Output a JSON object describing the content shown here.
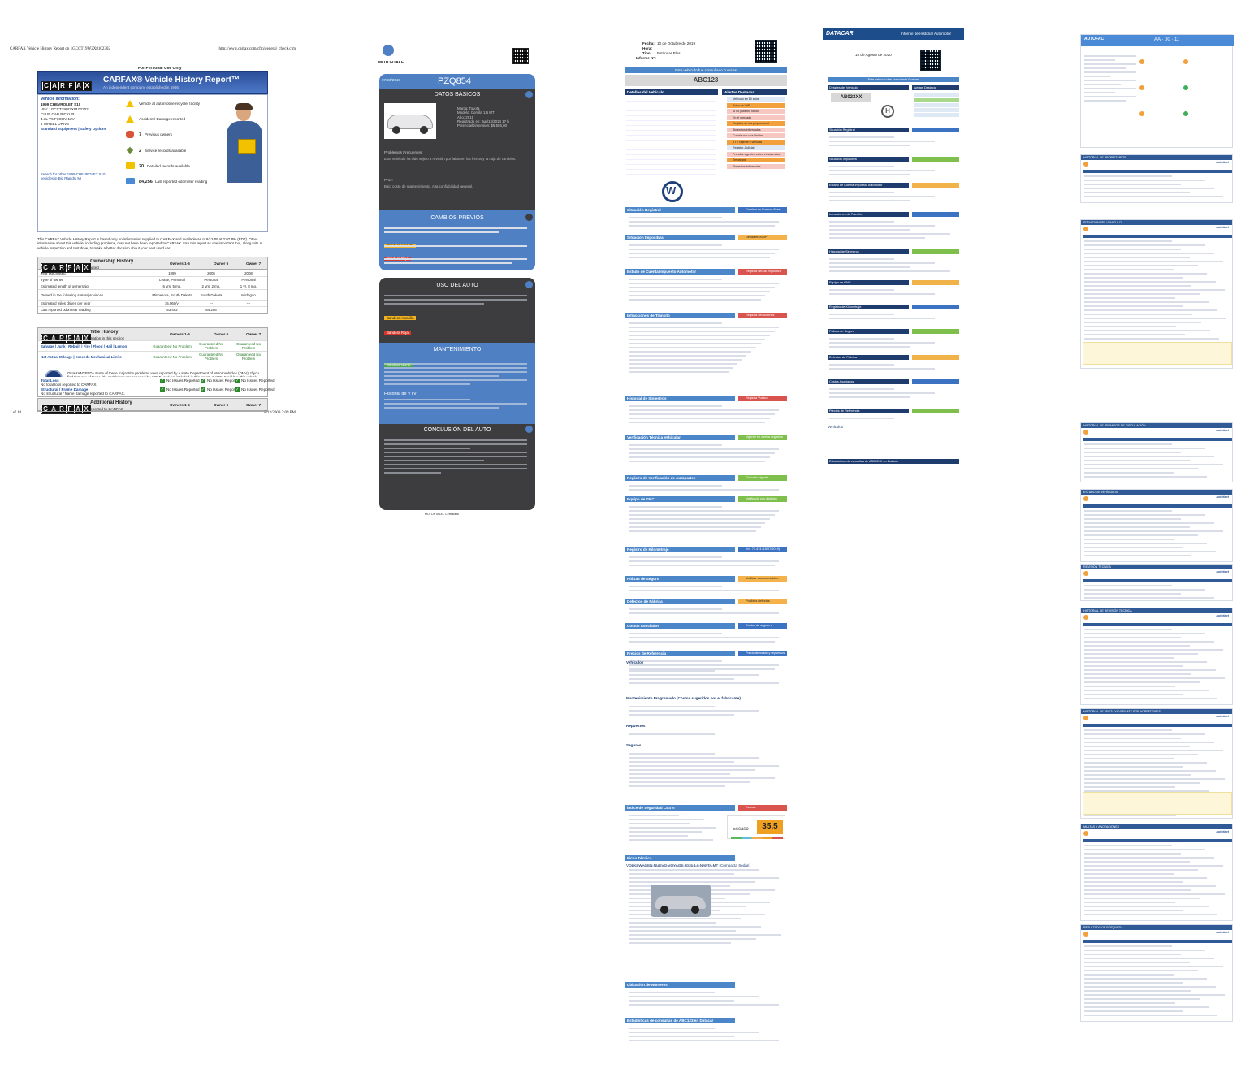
{
  "carfax": {
    "header_left": "CARFAX Vehicle History Report on 1GCCT19W2X8102302",
    "header_right": "http://www.carfax.com/cfm/general_check.cfm",
    "personal_use": "For Personal Use Only",
    "brand": "CARFAX",
    "report_title": "CARFAX® Vehicle History Report™",
    "report_sub": "An independent company established in 1986",
    "vehicle_info_label": "Vehicle Information:",
    "vehicle_lines": [
      "1999 CHEVROLET S10",
      "VIN: 1GCCT19W2X8102302",
      "CLUB CAB PICKUP",
      "4.3L V6 FI OHV 12V",
      "4 WHEEL DRIVE"
    ],
    "vehicle_links": "Standard Equipment | Safety Options",
    "search_text": "Search for other 1999 CHEVROLET S10 vehicles in Big Rapids, MI",
    "highlights": [
      {
        "icon": "warning-icon",
        "text": "Vehicle at automotive recycler facility"
      },
      {
        "icon": "warning-icon",
        "text": "Accident / Damage reported"
      },
      {
        "icon": "owners-icon",
        "num": "7",
        "text": "Previous owners"
      },
      {
        "icon": "service-icon",
        "num": "2",
        "text": "Service records available"
      },
      {
        "icon": "records-icon",
        "num": "20",
        "text": "Detailed records available"
      },
      {
        "icon": "odometer-icon",
        "num": "84,256",
        "text": "Last reported odometer reading"
      }
    ],
    "intro": "This CARFAX Vehicle History Report is based only on information supplied to CARFAX and available as of 8/12/09 at 2:07 PM (EDT). Other information about this vehicle, including problems, may not have been reported to CARFAX. Use this report as one important tool, along with a vehicle inspection and test drive, to make a better decision about your next used car.",
    "ownership": {
      "title": "Ownership History",
      "sub": "The number of owners is estimated",
      "cols": [
        "Owners 1-5",
        "Owner 6",
        "Owner 7"
      ],
      "rows": [
        [
          "Year purchased",
          "1999",
          "2005",
          "2008"
        ],
        [
          "Type of owner",
          "Lease, Personal",
          "Personal",
          "Personal"
        ],
        [
          "Estimated length of ownership",
          "6 yrs. 5 mo.",
          "2 yrs. 2 mo.",
          "1 yr. 8 mo."
        ],
        [
          "Owned in the following states/provinces",
          "Minnesota, South Dakota",
          "South Dakota",
          "Michigan"
        ],
        [
          "Estimated miles driven per year",
          "16,060/yr",
          "---",
          "---"
        ],
        [
          "Last reported odometer reading",
          "53,492",
          "84,256",
          ""
        ]
      ]
    },
    "title_history": {
      "title": "Title History",
      "sub": "CARFAX guarantees the information in this section",
      "cols": [
        "Owners 1-5",
        "Owner 6",
        "Owner 7"
      ],
      "rows": [
        [
          "Salvage | Junk | Rebuilt | Fire | Flood | Hail | Lemon",
          "Guaranteed No Problem",
          "Guaranteed No Problem",
          "Guaranteed No Problem"
        ],
        [
          "Not Actual Mileage | Exceeds Mechanical Limits",
          "Guaranteed No Problem",
          "Guaranteed No Problem",
          "Guaranteed No Problem"
        ]
      ],
      "guarantee": "GUARANTEED - None of these major title problems were reported by a state Department of Motor Vehicles (DMV). If you find that any of these title problems were reported by a DMV and not included in this report, CARFAX will buy this vehicle back. Register | View Terms"
    },
    "additional": {
      "title": "Additional History",
      "sub": "Not all accidents / issues are reported to CARFAX",
      "cols": [
        "Owners 1-5",
        "Owner 6",
        "Owner 7"
      ],
      "rows": [
        [
          "Total Loss",
          "No total loss reported to CARFAX.",
          "No Issues Reported",
          "No Issues Reported",
          "No Issues Reported"
        ],
        [
          "Structural / Frame Damage",
          "No structural / frame damage reported to CARFAX.",
          "No Issues Reported",
          "No Issues Reported",
          "No Issues Reported"
        ]
      ]
    },
    "footer_left": "1 of 14",
    "footer_right": "8/12/2009 2:09 PM"
  },
  "motortale": {
    "brand": "MOTORTALE",
    "date": "07/03/2019",
    "plate": "PZQ854",
    "datos_title": "DATOS BÁSICOS",
    "datos_lines": [
      "Marca: Toyota",
      "Modelo: Corolla 1.6 MT",
      "Año: 2015",
      "Registrado en: Jun/12/2014 17 h",
      "Potencia/Dimensión: $5.555,00"
    ],
    "problems_title": "Problemas Frecuentes:",
    "problems_text": "Este vehículo ha sido sujeto a revisión por fallas en los frenos y la caja de cambios.",
    "pros_title": "Pros:",
    "pros_text": "Bajo costo de mantenimiento. Alta confiabilidad general.",
    "cambios_title": "CAMBIOS PREVIOS",
    "bandera_amarilla": "Bandera Amarilla",
    "bandera_roja": "Bandera Roja",
    "bandera_verde": "Bandera Verde",
    "uso_title": "USO DEL AUTO",
    "mant_title": "MANTENIMIENTO",
    "historial_vtv": "Historial de VTV",
    "conclusion_title": "CONCLUSIÓN DEL AUTO",
    "footer": "MOTORTALE - Certificado"
  },
  "ab_report": {
    "fecha_label": "Fecha:",
    "fecha": "10 de Octubre de 2019",
    "hora_label": "Hora:",
    "tipo_label": "Tipo:",
    "tipo": "Estándar Plus",
    "informe_label": "Informe N°:",
    "consult_bar": "Este vehículo fue consultado 0 veces",
    "plate": "ABC123",
    "detalles": "Detalles del Vehículo",
    "alertas": "Alertas Destacar",
    "alert_items": [
      "Vehículo en 10 años",
      "Robo de VAP",
      "Si no pidieron robos",
      "En el mercado",
      "Registro de ida proporcional",
      "Siniestros informados",
      "Cuenta con una Unidad",
      "VTV vigente o vencida",
      "Registro Judicial",
      "Prendas vigentes sobre el automotor",
      "Embargos",
      "Siniestros informados"
    ],
    "sections": [
      {
        "title": "Situación Registral",
        "status": "Dominio en Buenos Aires",
        "cls": "st-b"
      },
      {
        "title": "Situación Impositiva",
        "status": "Deuda en AGIP",
        "cls": "st-o"
      },
      {
        "title": "Estado de Cuenta Impuesto Automotor",
        "status": "Registra deuda impositiva",
        "cls": "st-r"
      },
      {
        "title": "Infracciones de Tránsito",
        "status": "Registra infracciones",
        "cls": "st-r"
      },
      {
        "title": "Historial de Siniestros",
        "status": "Registra Vuelco",
        "cls": "st-r"
      },
      {
        "title": "Verificación Técnica Vehicular",
        "status": "Vigente en ciertos registros",
        "cls": "st-g"
      },
      {
        "title": "Registro de Verificación de Autopartes",
        "status": "Grabado vigente",
        "cls": "st-g"
      },
      {
        "title": "Equipo de GNC",
        "status": "Verificado con distintos registros",
        "cls": "st-g"
      },
      {
        "title": "Registro de Kilometraje",
        "status": "Km. 73.474 (15/07/2019)",
        "cls": "st-b"
      },
      {
        "title": "Pólizas de Seguro",
        "status": "Verificar documentación",
        "cls": "st-o"
      },
      {
        "title": "Defectos de Fábrica",
        "status": "Posibles defectos",
        "cls": "st-o"
      },
      {
        "title": "Costos Asociados",
        "status": "Costos de seguro e impuestos",
        "cls": "st-b"
      },
      {
        "title": "Precios de Referencia",
        "status": "Precio de usado y repuestos",
        "cls": "st-b"
      }
    ],
    "vehiculos": "Vehículos",
    "mantenimiento": "Mantenimiento Programado (Costos sugeridos por el fabricante)",
    "repuestos": "Repuestos",
    "seguros": "Seguros",
    "indice": "Índice de Seguridad CESVI",
    "indice_label": "Escaso",
    "indice_value": "35,5",
    "indice_status": "Escaso",
    "ficha": "Ficha Técnica",
    "ficha_model": "VOLKSWAGEN NUEVO VOYAGE 2015 1.6 NAFTA MT (Compacta Sedán)",
    "ubicacion": "Ubicación de Números",
    "estadisticas": "Estadísticas de consultas de ABC123 en Datacar"
  },
  "ab2": {
    "brand": "DATACAR",
    "header": "Informe de Historial Automotor",
    "fecha": "15 de Agosto de 2020",
    "consult_bar": "Este vehículo fue consultado 0 veces",
    "plate": "AB023XX",
    "detalles": "Detalles del Vehículo",
    "alertas": "Alertas Destacar",
    "sections": [
      "Situación Registral",
      "Situación Impositiva",
      "Estado de Cuenta Impuesto Automotor",
      "Infracciones de Tránsito",
      "Historial de Siniestros",
      "Equipo de GNC",
      "Registro de Kilometraje",
      "Pólizas de Seguro",
      "Defectos de Fábrica",
      "Costos Asociados",
      "Precios de Referencia"
    ],
    "vehiculos": "Vehículos",
    "estadisticas": "Estadísticas de consultas de AB023XX en Datacar"
  },
  "autofact": {
    "brand": "AUTOFACT",
    "plate": "AA · 00 · 11",
    "sections": [
      "HISTORIAL DE PROPIETARIOS",
      "SITUACIÓN DEL VEHÍCULO",
      "HISTORIAL DE PERMISOS DE CIRCULACIÓN",
      "ESTADO DE VEHÍCULOS",
      "REVISIÓN TÉCNICA",
      "HISTORIAL DE REVISIÓN TÉCNICA",
      "HISTORIAL DE VENTA Y/O REMATE POR ACREEDORES",
      "MULTAS Y ANOTACIONES",
      "RESULTADO DE BÚSQUEDA"
    ],
    "link": "autofact"
  }
}
